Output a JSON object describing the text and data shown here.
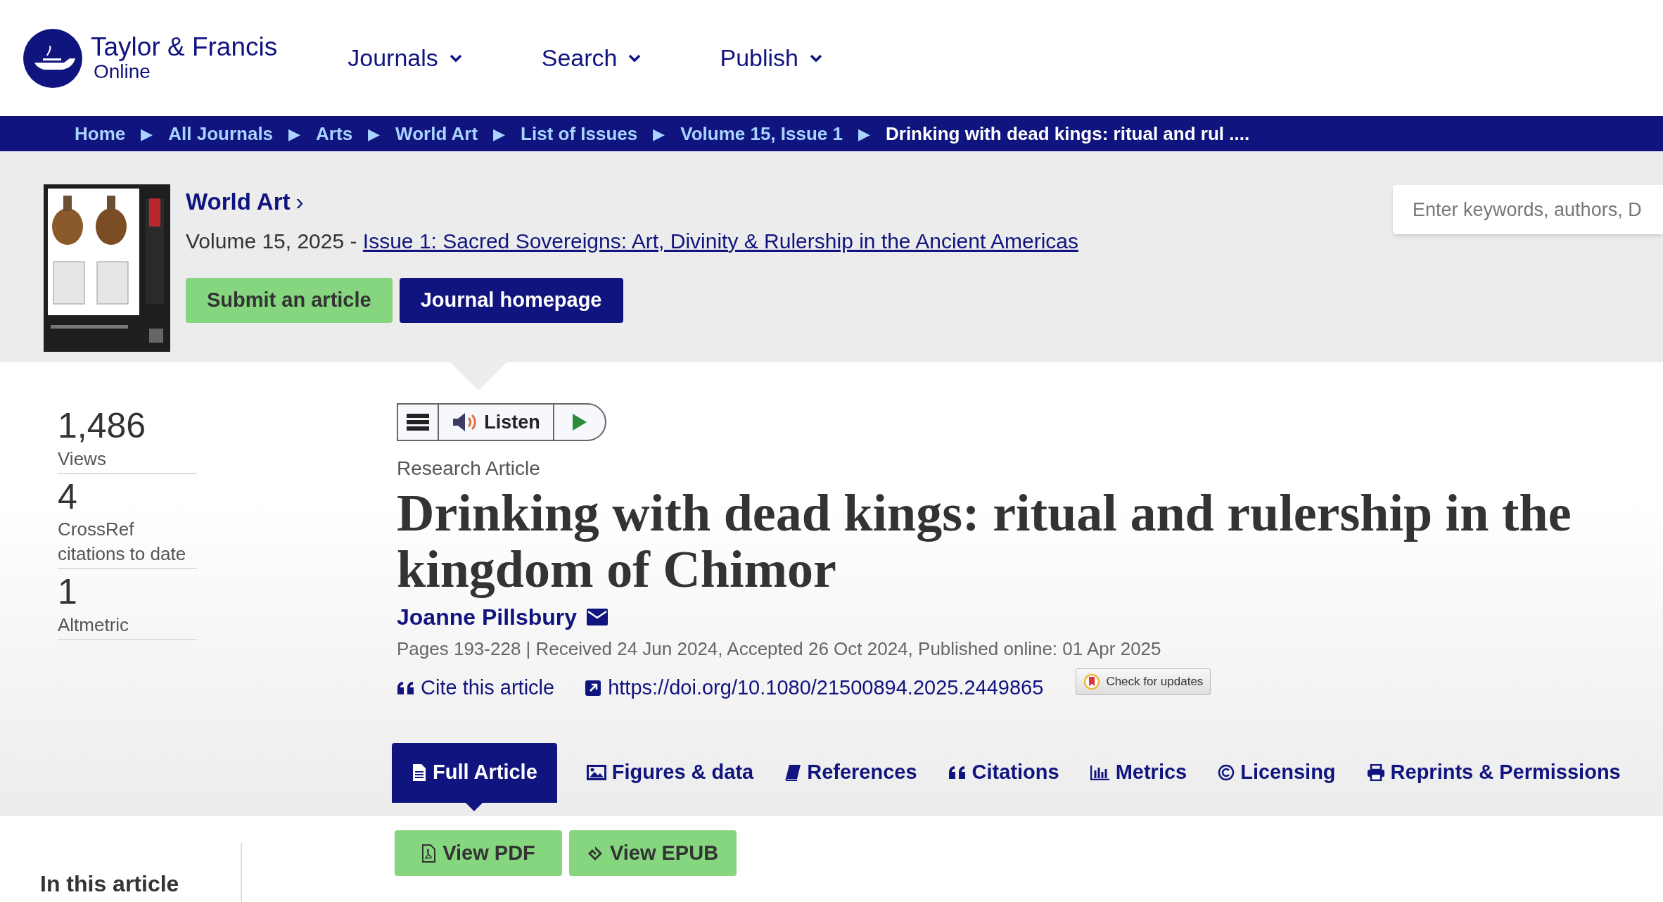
{
  "header": {
    "logo_line1": "Taylor & Francis",
    "logo_line2": "Online",
    "nav": [
      "Journals",
      "Search",
      "Publish"
    ]
  },
  "breadcrumbs": [
    {
      "label": "Home",
      "current": false
    },
    {
      "label": "All Journals",
      "current": false
    },
    {
      "label": "Arts",
      "current": false
    },
    {
      "label": "World Art",
      "current": false
    },
    {
      "label": "List of Issues",
      "current": false
    },
    {
      "label": "Volume 15, Issue 1",
      "current": false
    },
    {
      "label": "Drinking with dead kings: ritual and rul ....",
      "current": true
    }
  ],
  "separator": "▶",
  "journal": {
    "title": "World Art",
    "chevron": "›",
    "volume": "Volume 15, 2025 - ",
    "issue_link": "Issue 1: Sacred Sovereigns: Art, Divinity & Rulership in the Ancient Americas",
    "buttons": [
      {
        "label": "Submit an article",
        "kind": "green"
      },
      {
        "label": "Journal homepage",
        "kind": "navy"
      }
    ]
  },
  "search": {
    "placeholder": "Enter keywords, authors, D"
  },
  "metrics": [
    {
      "value": "1,486",
      "label": "Views"
    },
    {
      "value": "4",
      "label": "CrossRef citations to date"
    },
    {
      "value": "1",
      "label": "Altmetric"
    }
  ],
  "listen": {
    "label": "Listen"
  },
  "article": {
    "type": "Research Article",
    "title": "Drinking with dead kings: ritual and rulership in the kingdom of Chimor",
    "author": "Joanne Pillsbury",
    "meta": "Pages 193-228 | Received 24 Jun 2024, Accepted 26 Oct 2024, Published online: 01 Apr 2025",
    "cite": "Cite this article",
    "doi": "https://doi.org/10.1080/21500894.2025.2449865",
    "updates": "Check for updates"
  },
  "tabs": [
    {
      "label": "Full Article",
      "selected": true
    },
    {
      "label": "Figures & data",
      "selected": false
    },
    {
      "label": "References",
      "selected": false
    },
    {
      "label": "Citations",
      "selected": false
    },
    {
      "label": "Metrics",
      "selected": false
    },
    {
      "label": "Licensing",
      "selected": false
    },
    {
      "label": "Reprints & Permissions",
      "selected": false
    }
  ],
  "downloads": [
    {
      "label": "View PDF"
    },
    {
      "label": "View EPUB"
    }
  ],
  "sidebar": {
    "heading": "In this article"
  }
}
